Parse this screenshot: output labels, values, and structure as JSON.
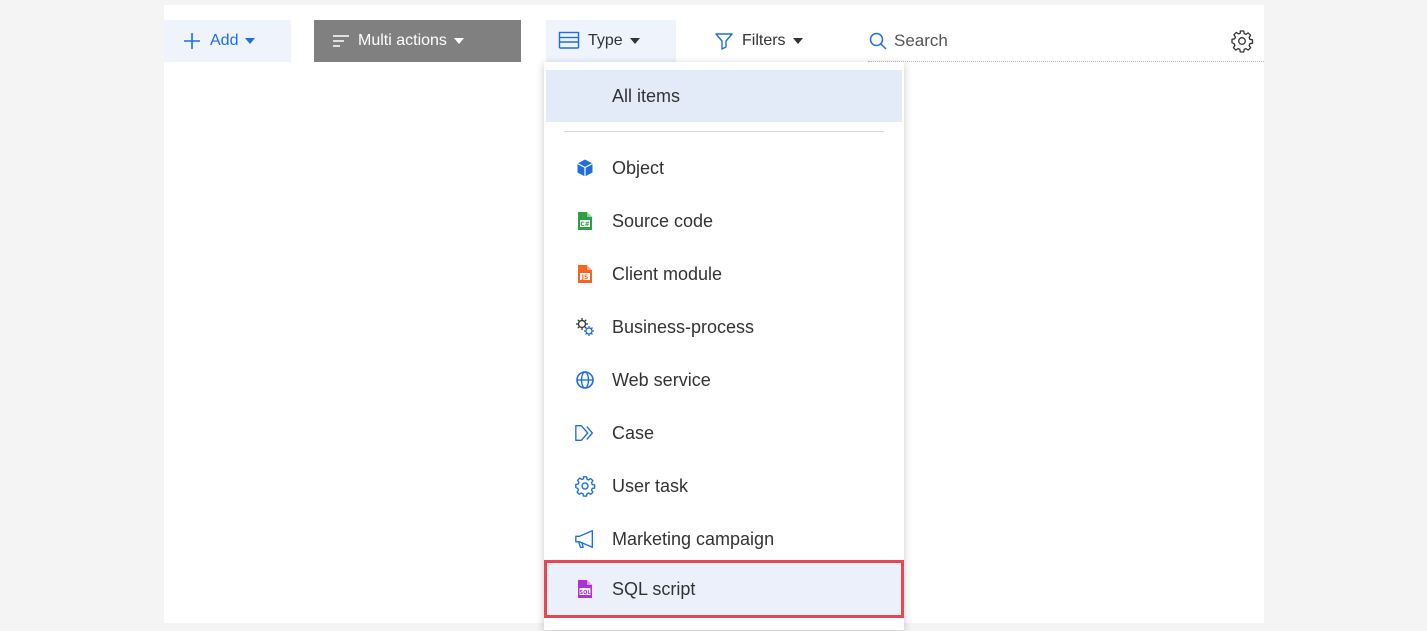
{
  "toolbar": {
    "add_label": "Add",
    "multi_actions_label": "Multi actions",
    "type_label": "Type",
    "filters_label": "Filters",
    "search_placeholder": "Search"
  },
  "type_menu": {
    "all_items": "All items",
    "items": [
      {
        "label": "Object",
        "icon": "cube-icon"
      },
      {
        "label": "Source code",
        "icon": "csharp-file-icon"
      },
      {
        "label": "Client module",
        "icon": "js-file-icon"
      },
      {
        "label": "Business-process",
        "icon": "gears-icon"
      },
      {
        "label": "Web service",
        "icon": "globe-icon"
      },
      {
        "label": "Case",
        "icon": "case-arrow-icon"
      },
      {
        "label": "User task",
        "icon": "gear-icon"
      },
      {
        "label": "Marketing campaign",
        "icon": "megaphone-icon"
      },
      {
        "label": "SQL script",
        "icon": "sql-file-icon"
      }
    ],
    "selected_index": 8
  },
  "colors": {
    "accent_blue": "#1f6fe0",
    "selection_border": "#e84651",
    "source_code_green": "#2ea043",
    "client_module_orange": "#f26522",
    "sql_purple": "#b12fd8"
  }
}
